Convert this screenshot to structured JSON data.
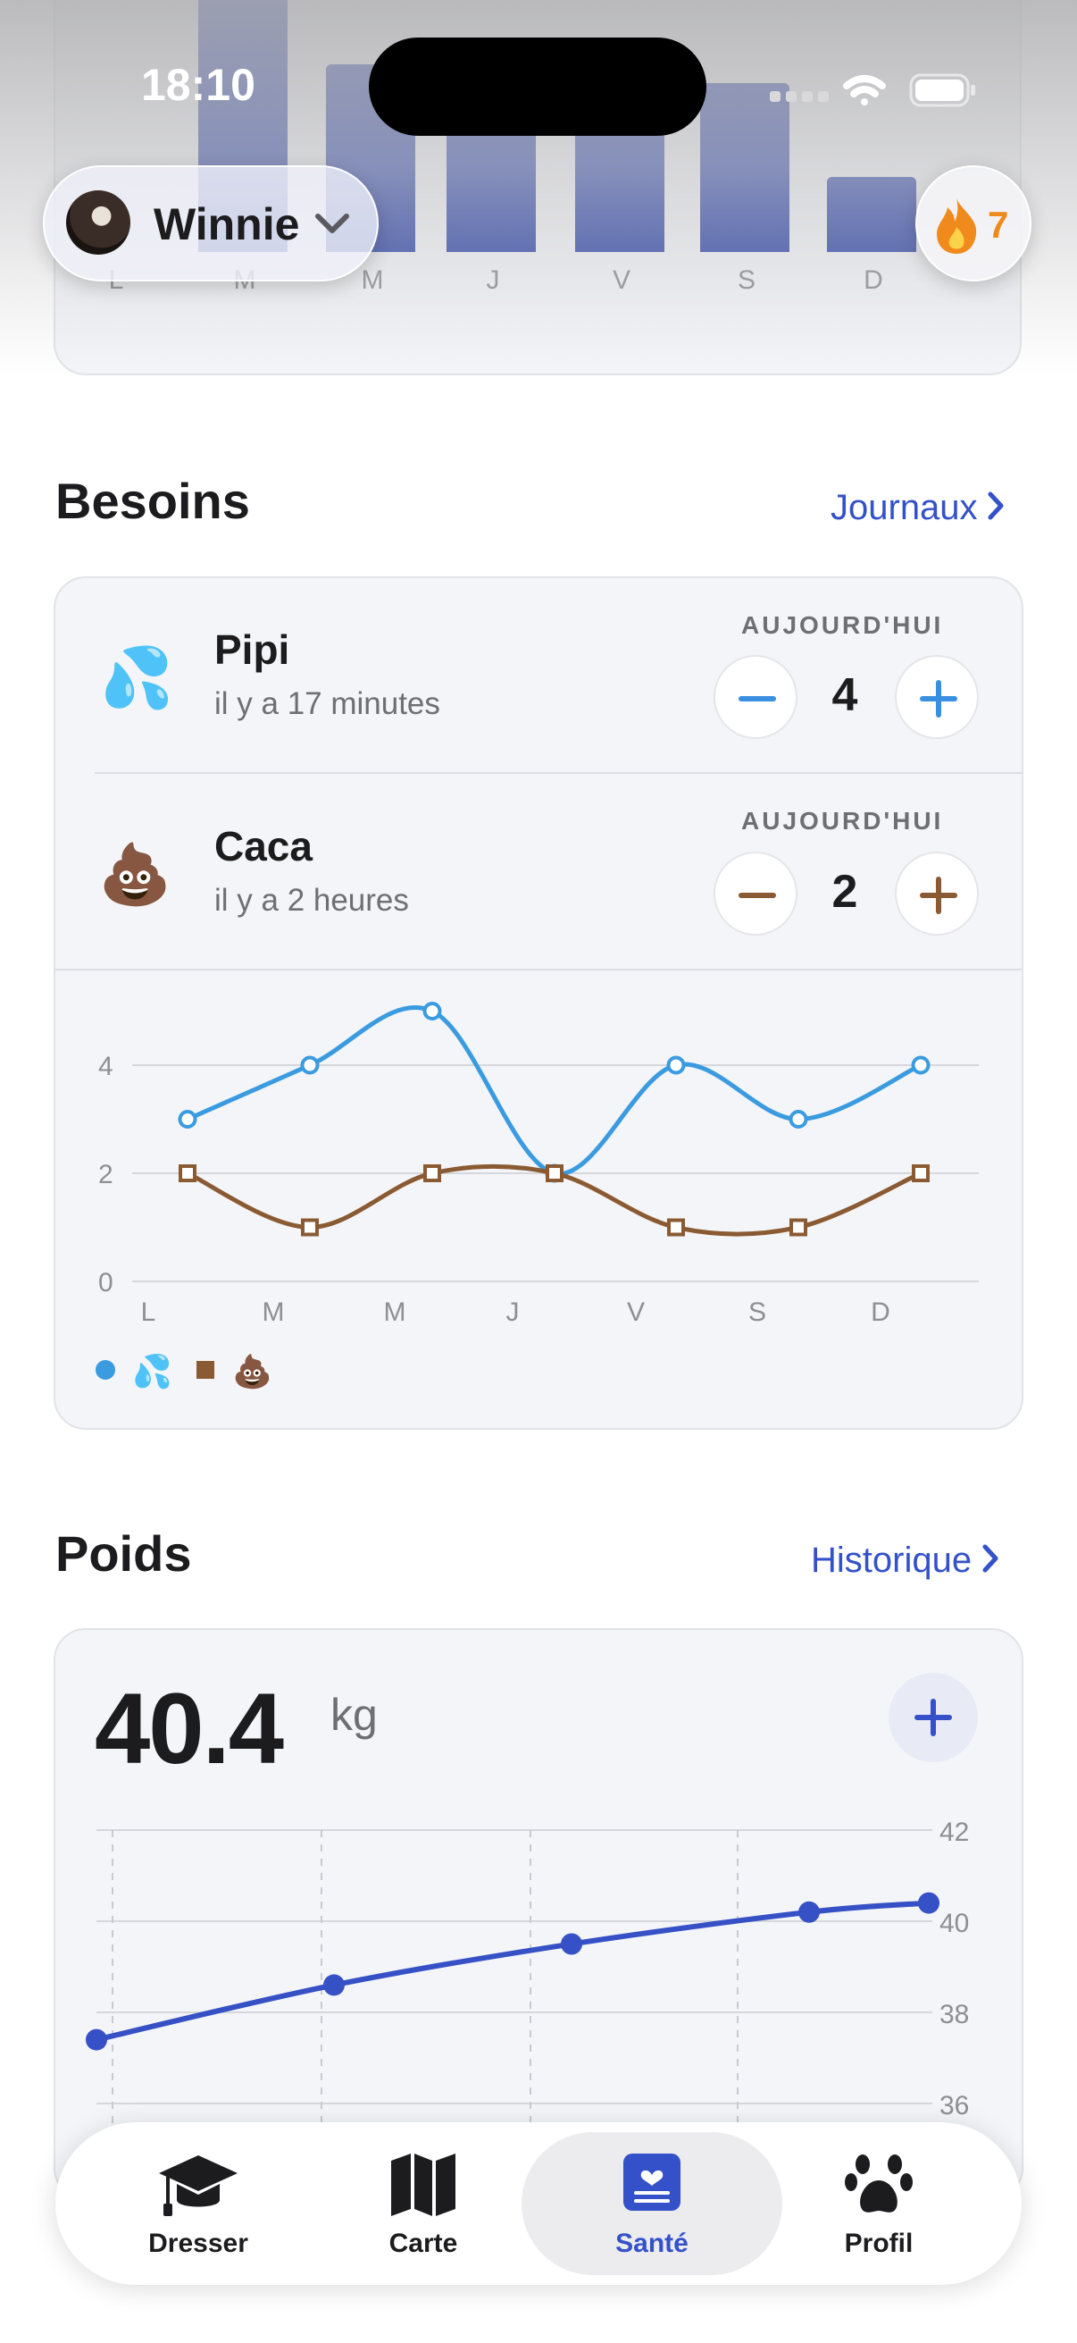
{
  "status_bar": {
    "time": "18:10"
  },
  "header": {
    "dog_name": "Winnie",
    "streak_count": "7",
    "icons": [
      "avatar",
      "chevron-down-icon",
      "flame-icon"
    ]
  },
  "activity_chart": {
    "days": [
      "L",
      "M",
      "M",
      "J",
      "V",
      "S",
      "D"
    ],
    "bar_fraction": [
      1.0,
      0.7,
      0.6,
      0.58,
      0.63,
      0.28
    ],
    "bar_color": "#2d44a8"
  },
  "besoins": {
    "title": "Besoins",
    "link": "Journaux",
    "items": [
      {
        "emoji": "💦",
        "name": "Pipi",
        "time": "il y a 17 minutes",
        "today_label": "AUJOURD'HUI",
        "count": "4",
        "accent": "#3a8fe0"
      },
      {
        "emoji": "💩",
        "name": "Caca",
        "time": "il y a 2 heures",
        "today_label": "AUJOURD'HUI",
        "count": "2",
        "accent": "#8a5a33"
      }
    ],
    "legend": [
      {
        "marker": "circle",
        "color": "#3a9be0",
        "emoji": "💦"
      },
      {
        "marker": "square",
        "color": "#8a5a33",
        "emoji": "💩"
      }
    ]
  },
  "chart_data": {
    "type": "line",
    "categories": [
      "L",
      "M",
      "M",
      "J",
      "V",
      "S",
      "D"
    ],
    "series": [
      {
        "values": [
          3,
          4,
          5,
          2,
          4,
          3,
          4
        ],
        "color": "#3a9be0",
        "marker": "circle"
      },
      {
        "values": [
          2,
          1,
          2,
          2,
          1,
          1,
          2
        ],
        "color": "#8a5a33",
        "marker": "square"
      }
    ],
    "yticks": [
      "0",
      "2",
      "4"
    ],
    "ylim": [
      0,
      5
    ],
    "grid": true,
    "legend_position": "bottom-left"
  },
  "poids": {
    "title": "Poids",
    "link": "Historique",
    "value": "40.4",
    "unit": "kg",
    "add_icon": "plus-icon",
    "chart": {
      "type": "line",
      "yticks": [
        "42",
        "40",
        "38",
        "36"
      ],
      "ylim": [
        36,
        42
      ],
      "values": [
        37.4,
        38.6,
        39.5,
        40.2,
        40.4
      ],
      "color": "#3651c6"
    }
  },
  "tabbar": {
    "tabs": [
      {
        "label": "Dresser",
        "icon": "graduation-cap-icon",
        "active": false
      },
      {
        "label": "Carte",
        "icon": "map-icon",
        "active": false
      },
      {
        "label": "Santé",
        "icon": "health-notebook-icon",
        "active": true
      },
      {
        "label": "Profil",
        "icon": "paw-icon",
        "active": false
      }
    ]
  }
}
